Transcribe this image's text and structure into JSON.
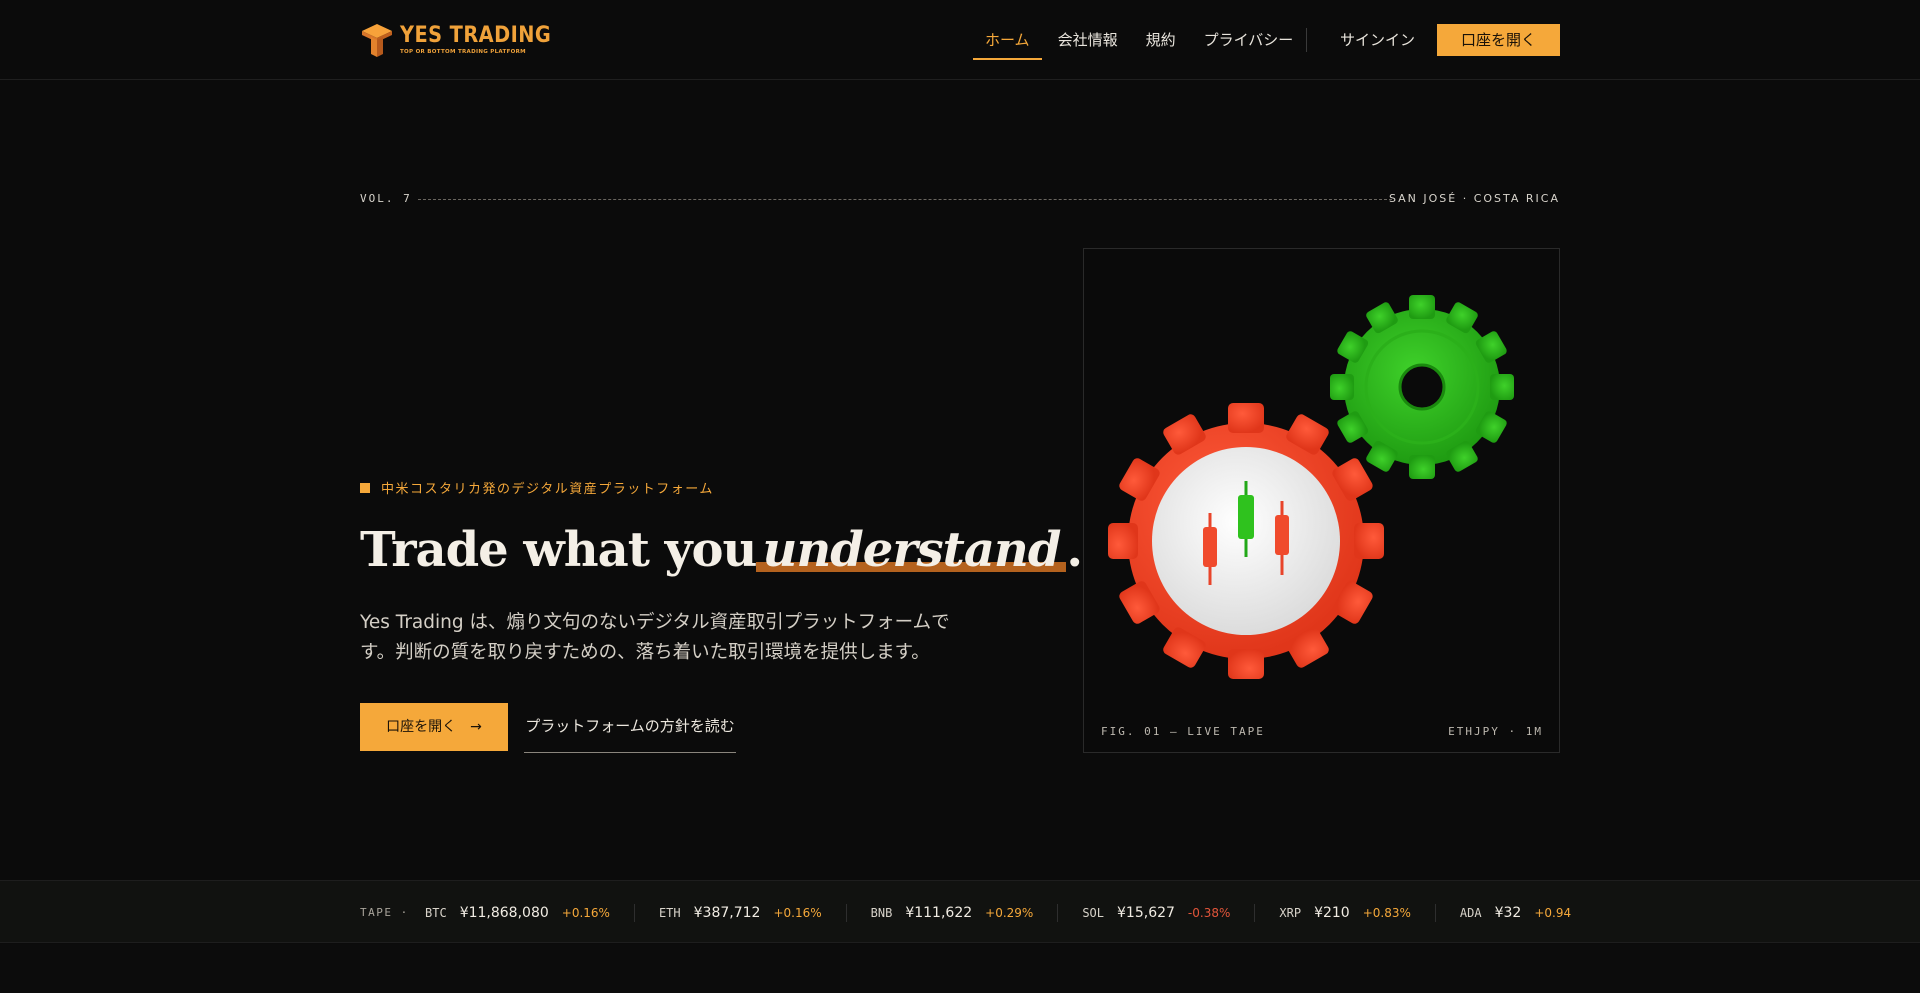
{
  "brand": {
    "title": "YES TRADING",
    "tagline": "TOP OR BOTTOM TRADING PLATFORM",
    "accent": "#f5a83a"
  },
  "nav": {
    "items": [
      {
        "label": "ホーム",
        "active": true
      },
      {
        "label": "会社情報"
      },
      {
        "label": "規約"
      },
      {
        "label": "プライバシー"
      }
    ],
    "signin": "サインイン",
    "open_account": "口座を開く"
  },
  "masthead": {
    "volume": "VOL. 7",
    "location": "SAN JOSÉ · COSTA RICA"
  },
  "hero": {
    "eyebrow": "中米コスタリカ発のデジタル資産プラットフォーム",
    "headline_pre": "Trade what you",
    "headline_em": "understand",
    "headline_post": ".",
    "description": "Yes Trading は、煽り文句のないデジタル資産取引プラットフォームです。判断の質を取り戻すための、落ち着いた取引環境を提供します。",
    "cta_primary": "口座を開く　→",
    "cta_secondary": "プラットフォームの方針を読む"
  },
  "figure": {
    "caption": "FIG. 01 — LIVE TAPE",
    "pair": "ETHJPY · 1M"
  },
  "tape": {
    "label": "TAPE ·",
    "items": [
      {
        "symbol": "BTC",
        "price": "¥11,868,080",
        "change": "+0.16%",
        "negative": false
      },
      {
        "symbol": "ETH",
        "price": "¥387,712",
        "change": "+0.16%",
        "negative": false
      },
      {
        "symbol": "BNB",
        "price": "¥111,622",
        "change": "+0.29%",
        "negative": false
      },
      {
        "symbol": "SOL",
        "price": "¥15,627",
        "change": "-0.38%",
        "negative": true
      },
      {
        "symbol": "XRP",
        "price": "¥210",
        "change": "+0.83%",
        "negative": false
      },
      {
        "symbol": "ADA",
        "price": "¥32",
        "change": "+0.94",
        "negative": false
      }
    ]
  }
}
